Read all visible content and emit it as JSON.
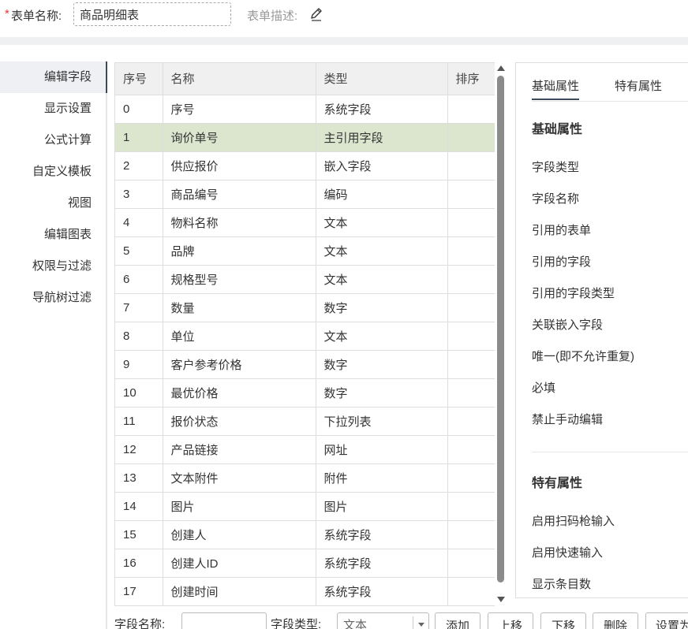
{
  "header": {
    "required_mark": "*",
    "form_name_label": "表单名称:",
    "form_name_value": "商品明细表",
    "form_desc_label": "表单描述:"
  },
  "nav": {
    "items": [
      {
        "label": "编辑字段",
        "active": true
      },
      {
        "label": "显示设置"
      },
      {
        "label": "公式计算"
      },
      {
        "label": "自定义模板"
      },
      {
        "label": "视图"
      },
      {
        "label": "编辑图表"
      },
      {
        "label": "权限与过滤"
      },
      {
        "label": "导航树过滤"
      }
    ]
  },
  "table": {
    "headers": [
      "序号",
      "名称",
      "类型",
      "排序"
    ],
    "selected_index": 1,
    "rows": [
      [
        "0",
        "序号",
        "系统字段",
        ""
      ],
      [
        "1",
        "询价单号",
        "主引用字段",
        ""
      ],
      [
        "2",
        "供应报价",
        "嵌入字段",
        ""
      ],
      [
        "3",
        "商品编号",
        "编码",
        ""
      ],
      [
        "4",
        "物料名称",
        "文本",
        ""
      ],
      [
        "5",
        "品牌",
        "文本",
        ""
      ],
      [
        "6",
        "规格型号",
        "文本",
        ""
      ],
      [
        "7",
        "数量",
        "数字",
        ""
      ],
      [
        "8",
        "单位",
        "文本",
        ""
      ],
      [
        "9",
        "客户参考价格",
        "数字",
        ""
      ],
      [
        "10",
        "最优价格",
        "数字",
        ""
      ],
      [
        "11",
        "报价状态",
        "下拉列表",
        ""
      ],
      [
        "12",
        "产品链接",
        "网址",
        ""
      ],
      [
        "13",
        "文本附件",
        "附件",
        ""
      ],
      [
        "14",
        "图片",
        "图片",
        ""
      ],
      [
        "15",
        "创建人",
        "系统字段",
        ""
      ],
      [
        "16",
        "创建人ID",
        "系统字段",
        ""
      ],
      [
        "17",
        "创建时间",
        "系统字段",
        ""
      ]
    ]
  },
  "panel": {
    "tabs": [
      "基础属性",
      "特有属性"
    ],
    "basic_title": "基础属性",
    "basic_props": [
      "字段类型",
      "字段名称",
      "引用的表单",
      "引用的字段",
      "引用的字段类型",
      "关联嵌入字段",
      "唯一(即不允许重复)",
      "必填",
      "禁止手动编辑"
    ],
    "special_title": "特有属性",
    "special_props": [
      "启用扫码枪输入",
      "启用快速输入",
      "显示条目数"
    ]
  },
  "bottom": {
    "field_name_label": "字段名称:",
    "field_type_label": "字段类型:",
    "field_type_value": "文本",
    "buttons": [
      "添加",
      "上移",
      "下移",
      "删除",
      "设置为"
    ]
  }
}
